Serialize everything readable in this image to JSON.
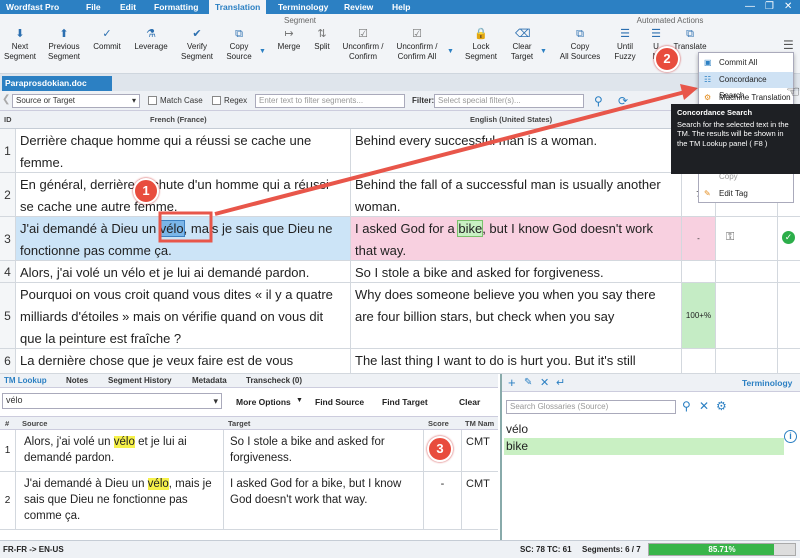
{
  "app": {
    "title": "Wordfast Pro"
  },
  "menu": [
    "File",
    "Edit",
    "Formatting",
    "Translation",
    "Terminology",
    "Review",
    "Help"
  ],
  "ribbon": {
    "group_segment": "Segment",
    "group_automated": "Automated Actions",
    "buttons": [
      {
        "l1": "Next",
        "l2": "Segment"
      },
      {
        "l1": "Previous",
        "l2": "Segment"
      },
      {
        "l1": "Commit",
        "l2": ""
      },
      {
        "l1": "Leverage",
        "l2": ""
      },
      {
        "l1": "Verify",
        "l2": "Segment"
      },
      {
        "l1": "Copy",
        "l2": "Source"
      },
      {
        "l1": "Merge",
        "l2": ""
      },
      {
        "l1": "Split",
        "l2": ""
      },
      {
        "l1": "Unconfirm /",
        "l2": "Confirm"
      },
      {
        "l1": "Unconfirm /",
        "l2": "Confirm All"
      },
      {
        "l1": "Lock",
        "l2": "Segment"
      },
      {
        "l1": "Clear",
        "l2": "Target"
      },
      {
        "l1": "Copy",
        "l2": "All Sources"
      },
      {
        "l1": "Until",
        "l2": "Fuzzy"
      },
      {
        "l1": "U",
        "l2": "M"
      },
      {
        "l1": "Translate",
        "l2": ""
      }
    ]
  },
  "file_tab": "Paraprosdokian.doc",
  "filter": {
    "scope": "Source or Target",
    "match_case": "Match Case",
    "regex": "Regex",
    "placeholder": "Enter text to filter segments...",
    "filter_label": "Filter:",
    "special_placeholder": "Select special filter(s)..."
  },
  "grid": {
    "col_id": "ID",
    "col_source": "French (France)",
    "col_target": "English (United States)",
    "rows": [
      {
        "id": "1",
        "src": "Derrière chaque homme qui a réussi se cache une femme.",
        "tgt": "Behind every successful man is a woman.",
        "score": ""
      },
      {
        "id": "2",
        "src": "En général, derrière la chute d'un homme qui a réussi se cache une autre femme.",
        "tgt": "Behind the fall of a successful man is usually another woman.",
        "score": "7"
      },
      {
        "id": "3",
        "src_pre": "J'ai demandé à Dieu un ",
        "src_hl": "vélo",
        "src_post": ", mais je sais que Dieu ne fonctionne pas comme ça.",
        "tgt_pre": "I asked God for a ",
        "tgt_hl": "bike",
        "tgt_post": ", but I know God doesn't work that way.",
        "score": "-"
      },
      {
        "id": "4",
        "src": "Alors, j'ai volé un vélo et je lui ai demandé pardon.",
        "tgt": "So I stole a bike and asked for forgiveness.",
        "score": ""
      },
      {
        "id": "5",
        "src": "Pourquoi on vous croit quand vous dites « il y a quatre milliards d'étoiles » mais on vérifie quand on vous dit que la peinture est fraîche ?",
        "tgt": "Why does someone believe you when you say there are four billion stars, but check when you say",
        "score": "100+%"
      },
      {
        "id": "6",
        "src": "La dernière chose que je veux faire est de vous",
        "tgt": "The last thing I want to do is hurt you. But it's still",
        "score": ""
      }
    ]
  },
  "dropdown": {
    "commit_all": "Commit All",
    "concordance": "Concordance Search",
    "machine": "Machine Translation",
    "copy": "Copy",
    "edit_tag": "Edit Tag"
  },
  "tooltip": {
    "title": "Concordance Search",
    "body": "Search for the selected text in the TM. The results will be shown in the TM Lookup panel ( F8 )"
  },
  "lower_tabs": [
    "TM Lookup",
    "Notes",
    "Segment History",
    "Metadata",
    "Transcheck (0)"
  ],
  "tm": {
    "query": "vélo",
    "more_options": "More Options",
    "find_source": "Find Source",
    "find_target": "Find Target",
    "clear": "Clear",
    "headers": {
      "num": "#",
      "source": "Source",
      "target": "Target",
      "score": "Score",
      "tmname": "TM Nam"
    },
    "rows": [
      {
        "n": "1",
        "src_pre": "Alors, j'ai volé un ",
        "src_hl": "vélo",
        "src_post": " et je lui ai demandé pardon.",
        "tgt": "So I stole a bike and asked for forgiveness.",
        "score": "",
        "tm": "CMT"
      },
      {
        "n": "2",
        "src_pre": "J'ai demandé à Dieu un ",
        "src_hl": "vélo",
        "src_post": ", mais je sais que Dieu ne fonctionne pas comme ça.",
        "tgt": "I asked God for a bike, but I know God doesn't work that way.",
        "score": "-",
        "tm": "CMT"
      }
    ]
  },
  "terminology": {
    "title": "Terminology",
    "search_placeholder": "Search Glossaries (Source)",
    "source_term": "vélo",
    "target_term": "bike"
  },
  "status": {
    "langs": "FR-FR -> EN-US",
    "counts": "SC: 78 TC: 61",
    "segments": "Segments: 6 / 7",
    "progress_label": "85.71%",
    "progress": 0.8571
  },
  "badges": [
    "1",
    "2",
    "3"
  ],
  "colors": {
    "accent": "#2c80c3",
    "badge": "#e84c3d",
    "arrow": "#e8564a",
    "active_row": "#cce4f7",
    "target_row": "#f8d0e0",
    "highlight": "#f6f14a"
  }
}
